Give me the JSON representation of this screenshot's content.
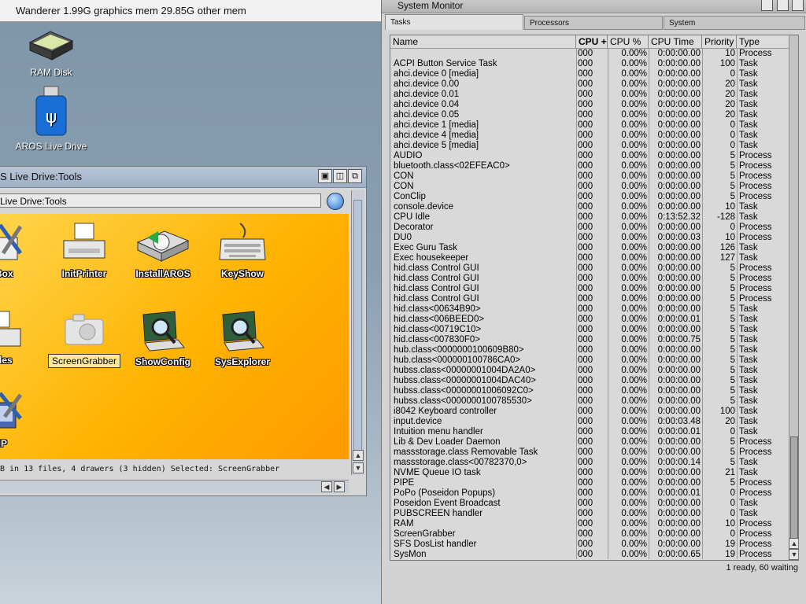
{
  "topbar": {
    "text": "Wanderer 1.99G graphics mem 29.85G other mem"
  },
  "desktop_icons": [
    {
      "label": "RAM Disk"
    },
    {
      "label": "AROS Live Drive"
    }
  ],
  "tools_window": {
    "title": "S Live Drive:Tools",
    "path": "Live Drive:Tools",
    "status": "B in 13 files, 4 drawers (3 hidden) Selected: ScreenGrabber",
    "icons": [
      {
        "label": "olBox"
      },
      {
        "label": "InitPrinter"
      },
      {
        "label": "InstallAROS"
      },
      {
        "label": "KeyShow"
      },
      {
        "label": "tFiles"
      },
      {
        "label": "ScreenGrabber"
      },
      {
        "label": "ShowConfig"
      },
      {
        "label": "SysExplorer"
      },
      {
        "label": "MP"
      }
    ]
  },
  "sysmon": {
    "title": "System Monitor",
    "tabs": [
      "Tasks",
      "Processors",
      "System"
    ],
    "columns": [
      "Name",
      "CPU +",
      "CPU %",
      "CPU Time",
      "Priority",
      "Type"
    ],
    "rows": [
      [
        "",
        "000",
        "0.00%",
        "0:00:00.00",
        "10",
        "Process"
      ],
      [
        "ACPI Button Service Task",
        "000",
        "0.00%",
        "0:00:00.00",
        "100",
        "Task"
      ],
      [
        "ahci.device 0 [media]",
        "000",
        "0.00%",
        "0:00:00.00",
        "0",
        "Task"
      ],
      [
        "ahci.device 0.00",
        "000",
        "0.00%",
        "0:00:00.00",
        "20",
        "Task"
      ],
      [
        "ahci.device 0.01",
        "000",
        "0.00%",
        "0:00:00.00",
        "20",
        "Task"
      ],
      [
        "ahci.device 0.04",
        "000",
        "0.00%",
        "0:00:00.00",
        "20",
        "Task"
      ],
      [
        "ahci.device 0.05",
        "000",
        "0.00%",
        "0:00:00.00",
        "20",
        "Task"
      ],
      [
        "ahci.device 1 [media]",
        "000",
        "0.00%",
        "0:00:00.00",
        "0",
        "Task"
      ],
      [
        "ahci.device 4 [media]",
        "000",
        "0.00%",
        "0:00:00.00",
        "0",
        "Task"
      ],
      [
        "ahci.device 5 [media]",
        "000",
        "0.00%",
        "0:00:00.00",
        "0",
        "Task"
      ],
      [
        "AUDIO",
        "000",
        "0.00%",
        "0:00:00.00",
        "5",
        "Process"
      ],
      [
        "bluetooth.class<02EFEAC0>",
        "000",
        "0.00%",
        "0:00:00.00",
        "5",
        "Process"
      ],
      [
        "CON",
        "000",
        "0.00%",
        "0:00:00.00",
        "5",
        "Process"
      ],
      [
        "CON",
        "000",
        "0.00%",
        "0:00:00.00",
        "5",
        "Process"
      ],
      [
        "ConClip",
        "000",
        "0.00%",
        "0:00:00.00",
        "5",
        "Process"
      ],
      [
        "console.device",
        "000",
        "0.00%",
        "0:00:00.00",
        "10",
        "Task"
      ],
      [
        "CPU Idle",
        "000",
        "0.00%",
        "0:13:52.32",
        "-128",
        "Task"
      ],
      [
        "Decorator",
        "000",
        "0.00%",
        "0:00:00.00",
        "0",
        "Process"
      ],
      [
        "DU0",
        "000",
        "0.00%",
        "0:00:00.03",
        "10",
        "Process"
      ],
      [
        "Exec Guru Task",
        "000",
        "0.00%",
        "0:00:00.00",
        "126",
        "Task"
      ],
      [
        "Exec housekeeper",
        "000",
        "0.00%",
        "0:00:00.00",
        "127",
        "Task"
      ],
      [
        "hid.class Control GUI",
        "000",
        "0.00%",
        "0:00:00.00",
        "5",
        "Process"
      ],
      [
        "hid.class Control GUI",
        "000",
        "0.00%",
        "0:00:00.00",
        "5",
        "Process"
      ],
      [
        "hid.class Control GUI",
        "000",
        "0.00%",
        "0:00:00.00",
        "5",
        "Process"
      ],
      [
        "hid.class Control GUI",
        "000",
        "0.00%",
        "0:00:00.00",
        "5",
        "Process"
      ],
      [
        "hid.class<00634B90>",
        "000",
        "0.00%",
        "0:00:00.00",
        "5",
        "Task"
      ],
      [
        "hid.class<006BEED0>",
        "000",
        "0.00%",
        "0:00:00.01",
        "5",
        "Task"
      ],
      [
        "hid.class<00719C10>",
        "000",
        "0.00%",
        "0:00:00.00",
        "5",
        "Task"
      ],
      [
        "hid.class<007830F0>",
        "000",
        "0.00%",
        "0:00:00.75",
        "5",
        "Task"
      ],
      [
        "hub.class<0000000100609B80>",
        "000",
        "0.00%",
        "0:00:00.00",
        "5",
        "Task"
      ],
      [
        "hub.class<000000100786CA0>",
        "000",
        "0.00%",
        "0:00:00.00",
        "5",
        "Task"
      ],
      [
        "hubss.class<00000001004DA2A0>",
        "000",
        "0.00%",
        "0:00:00.00",
        "5",
        "Task"
      ],
      [
        "hubss.class<00000001004DAC40>",
        "000",
        "0.00%",
        "0:00:00.00",
        "5",
        "Task"
      ],
      [
        "hubss.class<00000001006092C0>",
        "000",
        "0.00%",
        "0:00:00.00",
        "5",
        "Task"
      ],
      [
        "hubss.class<0000000100785530>",
        "000",
        "0.00%",
        "0:00:00.00",
        "5",
        "Task"
      ],
      [
        "i8042 Keyboard controller",
        "000",
        "0.00%",
        "0:00:00.00",
        "100",
        "Task"
      ],
      [
        "input.device",
        "000",
        "0.00%",
        "0:00:03.48",
        "20",
        "Task"
      ],
      [
        "Intuition menu handler",
        "000",
        "0.00%",
        "0:00:00.01",
        "0",
        "Task"
      ],
      [
        "Lib & Dev Loader Daemon",
        "000",
        "0.00%",
        "0:00:00.00",
        "5",
        "Process"
      ],
      [
        "massstorage.class Removable Task",
        "000",
        "0.00%",
        "0:00:00.00",
        "5",
        "Process"
      ],
      [
        "massstorage.class<00782370,0>",
        "000",
        "0.00%",
        "0:00:00.14",
        "5",
        "Task"
      ],
      [
        "NVME Queue IO task",
        "000",
        "0.00%",
        "0:00:00.00",
        "21",
        "Task"
      ],
      [
        "PIPE",
        "000",
        "0.00%",
        "0:00:00.00",
        "5",
        "Process"
      ],
      [
        "PoPo (Poseidon Popups)",
        "000",
        "0.00%",
        "0:00:00.01",
        "0",
        "Process"
      ],
      [
        "Poseidon Event Broadcast",
        "000",
        "0.00%",
        "0:00:00.00",
        "0",
        "Task"
      ],
      [
        "PUBSCREEN handler",
        "000",
        "0.00%",
        "0:00:00.00",
        "0",
        "Task"
      ],
      [
        "RAM",
        "000",
        "0.00%",
        "0:00:00.00",
        "10",
        "Process"
      ],
      [
        "ScreenGrabber",
        "000",
        "0.00%",
        "0:00:00.00",
        "0",
        "Process"
      ],
      [
        "SFS DosList handler",
        "000",
        "0.00%",
        "0:00:00.00",
        "19",
        "Process"
      ],
      [
        "SysMon",
        "000",
        "0.00%",
        "0:00:00.65",
        "19",
        "Process"
      ]
    ],
    "status": "1 ready, 60 waiting"
  }
}
